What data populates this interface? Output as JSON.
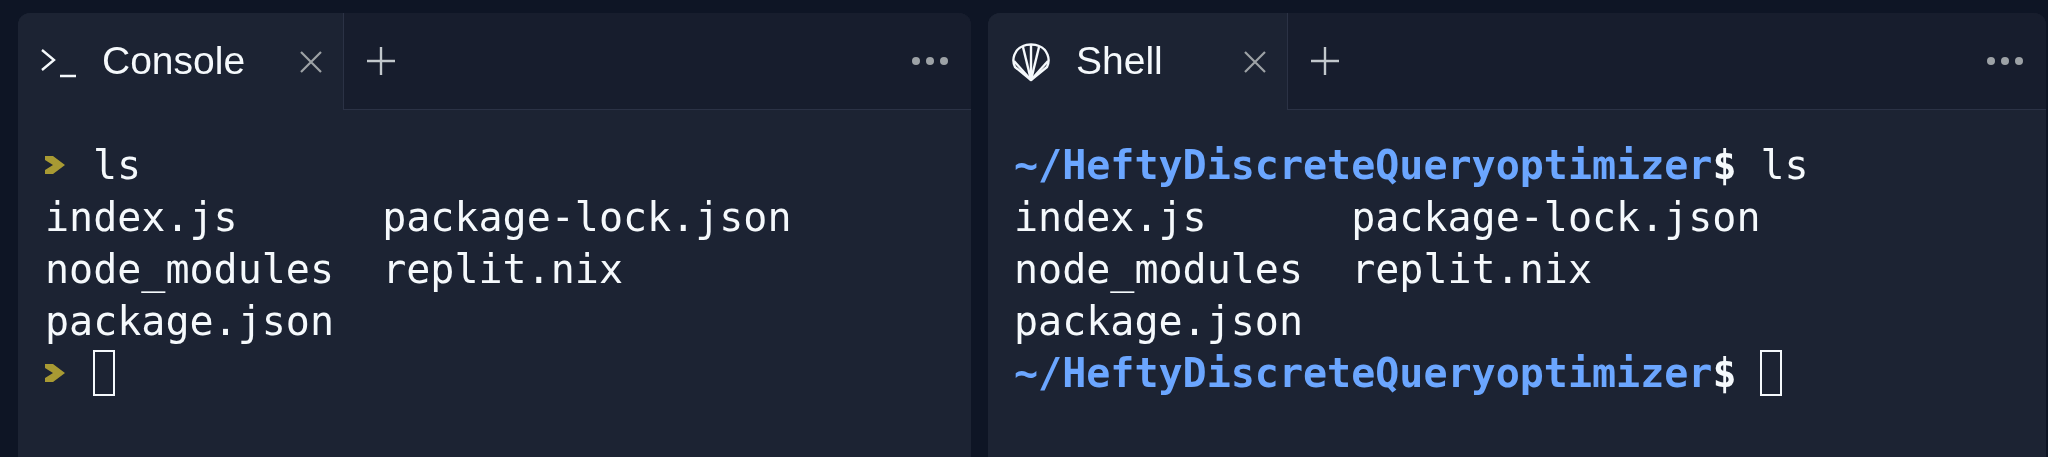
{
  "panes": [
    {
      "kind": "chevron",
      "tabs": [
        {
          "label": "Console",
          "kind": "terminal",
          "selected": true
        }
      ],
      "lines": [
        {
          "kind": "prompt",
          "command": "ls"
        },
        {
          "kind": "output",
          "columns": [
            "index.js",
            "package-lock.json"
          ]
        },
        {
          "kind": "output",
          "columns": [
            "node_modules",
            "replit.nix"
          ]
        },
        {
          "kind": "output",
          "columns": [
            "package.json"
          ]
        },
        {
          "kind": "prompt",
          "cursor": true
        }
      ]
    },
    {
      "kind": "path",
      "tabs": [
        {
          "label": "Shell",
          "kind": "shell",
          "selected": true
        }
      ],
      "lines": [
        {
          "kind": "prompt",
          "path": "~/HeftyDiscreteQueryoptimizer",
          "symbol": "$",
          "command": "ls"
        },
        {
          "kind": "output",
          "columns": [
            "index.js",
            "package-lock.json"
          ]
        },
        {
          "kind": "output",
          "columns": [
            "node_modules",
            "replit.nix"
          ]
        },
        {
          "kind": "output",
          "columns": [
            "package.json"
          ]
        },
        {
          "kind": "prompt",
          "path": "~/HeftyDiscreteQueryoptimizer",
          "symbol": "$",
          "cursor": true
        }
      ]
    }
  ]
}
